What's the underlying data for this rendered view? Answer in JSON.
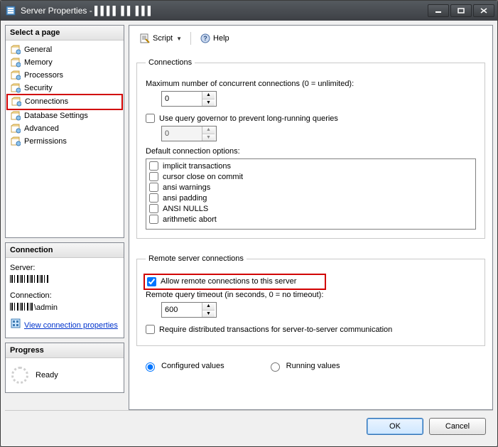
{
  "titlebar": {
    "title": "Server Properties - ▌▌▌▌ ▌▌ ▌▌▌"
  },
  "left": {
    "select_page_header": "Select a page",
    "pages": [
      {
        "label": "General"
      },
      {
        "label": "Memory"
      },
      {
        "label": "Processors"
      },
      {
        "label": "Security"
      },
      {
        "label": "Connections",
        "selected": true
      },
      {
        "label": "Database Settings"
      },
      {
        "label": "Advanced"
      },
      {
        "label": "Permissions"
      }
    ],
    "connection_header": "Connection",
    "server_label": "Server:",
    "server_value": "▌▌▌▌ ▌▌ ▌▌▌",
    "connection_label": "Connection:",
    "connection_value": "▌▌▌ ▌▌\\admin",
    "view_props_link": "View connection properties",
    "progress_header": "Progress",
    "progress_status": "Ready"
  },
  "toolbar": {
    "script_label": "Script",
    "help_label": "Help"
  },
  "connections_group": {
    "legend": "Connections",
    "max_conn_label": "Maximum number of concurrent connections (0 = unlimited):",
    "max_conn_value": "0",
    "governor_label": "Use query governor to prevent long-running queries",
    "governor_checked": false,
    "governor_value": "0",
    "default_options_label": "Default connection options:",
    "options": [
      {
        "label": "implicit transactions",
        "checked": false
      },
      {
        "label": "cursor close on commit",
        "checked": false
      },
      {
        "label": "ansi warnings",
        "checked": false
      },
      {
        "label": "ansi padding",
        "checked": false
      },
      {
        "label": "ANSI NULLS",
        "checked": false
      },
      {
        "label": "arithmetic abort",
        "checked": false
      }
    ]
  },
  "remote_group": {
    "legend": "Remote server connections",
    "allow_remote_label": "Allow remote connections to this server",
    "allow_remote_checked": true,
    "timeout_label": "Remote query timeout (in seconds, 0 = no timeout):",
    "timeout_value": "600",
    "require_dtc_label": "Require distributed transactions for server-to-server communication",
    "require_dtc_checked": false
  },
  "radios": {
    "configured_label": "Configured values",
    "running_label": "Running values",
    "selected": "configured"
  },
  "footer": {
    "ok_label": "OK",
    "cancel_label": "Cancel"
  }
}
